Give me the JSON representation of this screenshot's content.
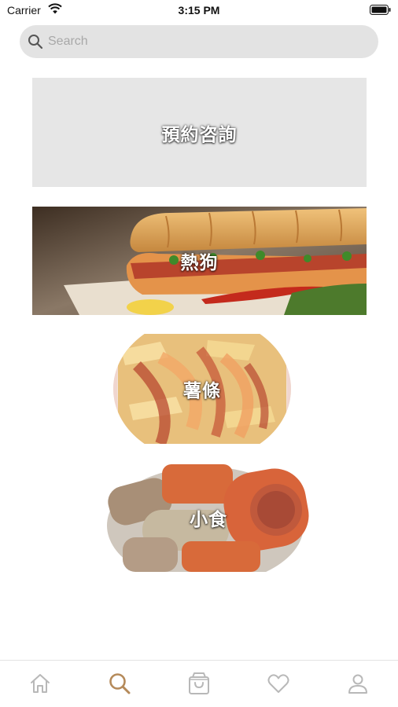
{
  "status_bar": {
    "carrier": "Carrier",
    "time": "3:15 PM"
  },
  "search": {
    "placeholder": "Search",
    "value": ""
  },
  "categories": [
    {
      "label": "預約咨詢"
    },
    {
      "label": "熱狗"
    },
    {
      "label": "薯條"
    },
    {
      "label": "小食"
    }
  ],
  "tab_bar": {
    "active_color": "#b58a5a",
    "inactive_color": "#b8b8b8",
    "items": [
      {
        "icon": "home-icon",
        "active": false
      },
      {
        "icon": "search-icon",
        "active": true
      },
      {
        "icon": "shopping-bag-icon",
        "active": false
      },
      {
        "icon": "heart-icon",
        "active": false
      },
      {
        "icon": "profile-icon",
        "active": false
      }
    ]
  }
}
